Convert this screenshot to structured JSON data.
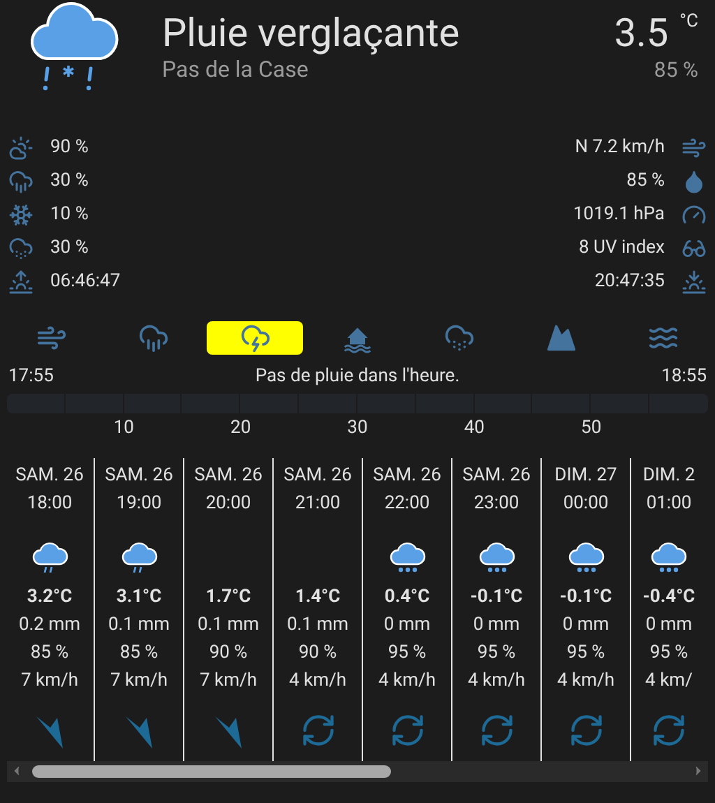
{
  "header": {
    "condition": "Pluie verglaçante",
    "location": "Pas de la Case",
    "temperature": "3.5",
    "unit": "°C",
    "humidity": "85 %"
  },
  "details_left": [
    {
      "kind": "cloudsun",
      "value": "90 %"
    },
    {
      "kind": "rain",
      "value": "30 %"
    },
    {
      "kind": "snowflake",
      "value": "10 %"
    },
    {
      "kind": "cloudsnow",
      "value": "30 %"
    },
    {
      "kind": "sunrise",
      "value": "06:46:47"
    }
  ],
  "details_right": [
    {
      "kind": "wind",
      "value": "N 7.2 km/h"
    },
    {
      "kind": "droplet",
      "value": "85 %"
    },
    {
      "kind": "gauge",
      "value": "1019.1 hPa"
    },
    {
      "kind": "glasses",
      "value": "8 UV index"
    },
    {
      "kind": "sunset",
      "value": "20:47:35"
    }
  ],
  "alert_tabs": [
    {
      "kind": "wind",
      "selected": false
    },
    {
      "kind": "rain",
      "selected": false
    },
    {
      "kind": "storm",
      "selected": true
    },
    {
      "kind": "flood",
      "selected": false
    },
    {
      "kind": "snow",
      "selected": false
    },
    {
      "kind": "mountain",
      "selected": false
    },
    {
      "kind": "waves",
      "selected": false
    }
  ],
  "rain_hour": {
    "start": "17:55",
    "message": "Pas de pluie dans l'heure.",
    "end": "18:55",
    "ticks": [
      "10",
      "20",
      "30",
      "40",
      "50"
    ]
  },
  "forecast": [
    {
      "day": "SAM. 26",
      "time": "18:00",
      "sky": {
        "kind": "rain"
      },
      "temp": "3.2°C",
      "precip": "0.2 mm",
      "humidity": "85 %",
      "wind": "7 km/h",
      "wind_symbol": {
        "kind": "arrow"
      }
    },
    {
      "day": "SAM. 26",
      "time": "19:00",
      "sky": {
        "kind": "rain"
      },
      "temp": "3.1°C",
      "precip": "0.1 mm",
      "humidity": "85 %",
      "wind": "7 km/h",
      "wind_symbol": {
        "kind": "arrow"
      }
    },
    {
      "day": "SAM. 26",
      "time": "20:00",
      "temp": "1.7°C",
      "precip": "0.1 mm",
      "humidity": "90 %",
      "wind": "7 km/h",
      "wind_symbol": {
        "kind": "arrow"
      }
    },
    {
      "day": "SAM. 26",
      "time": "21:00",
      "temp": "1.4°C",
      "precip": "0.1 mm",
      "humidity": "90 %",
      "wind": "4 km/h",
      "wind_symbol": {
        "kind": "calm"
      }
    },
    {
      "day": "SAM. 26",
      "time": "22:00",
      "sky": {
        "kind": "snow"
      },
      "temp": "0.4°C",
      "precip": "0 mm",
      "humidity": "95 %",
      "wind": "4 km/h",
      "wind_symbol": {
        "kind": "calm"
      }
    },
    {
      "day": "SAM. 26",
      "time": "23:00",
      "sky": {
        "kind": "snow"
      },
      "temp": "-0.1°C",
      "precip": "0 mm",
      "humidity": "95 %",
      "wind": "4 km/h",
      "wind_symbol": {
        "kind": "calm"
      }
    },
    {
      "day": "DIM. 27",
      "time": "00:00",
      "sky": {
        "kind": "snow"
      },
      "temp": "-0.1°C",
      "precip": "0 mm",
      "humidity": "95 %",
      "wind": "4 km/h",
      "wind_symbol": {
        "kind": "calm"
      }
    },
    {
      "day": "DIM. 2",
      "time": "01:00",
      "sky": {
        "kind": "snow"
      },
      "temp": "-0.4°C",
      "precip": "0 mm",
      "humidity": "95 %",
      "wind": "4 km/",
      "wind_symbol": {
        "kind": "calm"
      }
    }
  ]
}
